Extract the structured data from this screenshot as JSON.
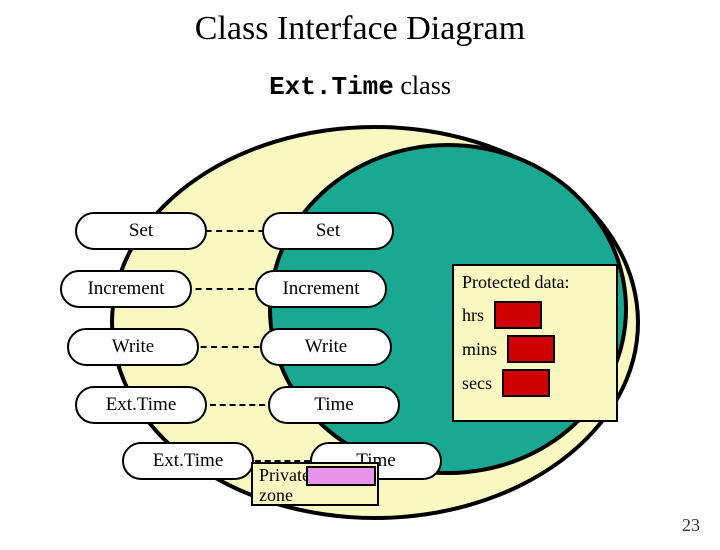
{
  "title": "Class Interface Diagram",
  "subtitle_mono": "Ext.Time",
  "subtitle_tail": " class",
  "left_pills": [
    "Set",
    "Increment",
    "Write",
    "Ext.Time",
    "Ext.Time"
  ],
  "right_pills": [
    "Set",
    "Increment",
    "Write",
    "Time",
    "Time"
  ],
  "protected": {
    "header": "Protected data:",
    "fields": [
      "hrs",
      "mins",
      "secs"
    ]
  },
  "private": {
    "header": "Private data:",
    "field": "zone"
  },
  "page": "23"
}
